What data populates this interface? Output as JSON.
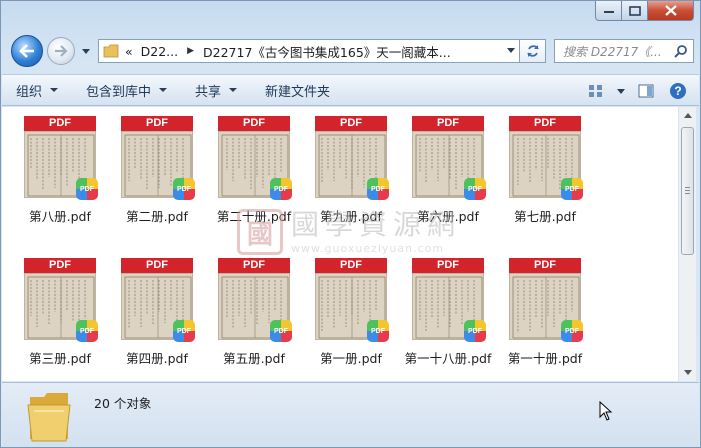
{
  "address": {
    "crumbs": [
      "«",
      "D22...",
      "D22717《古今图书集成165》天一阁藏本..."
    ]
  },
  "search": {
    "placeholder": "搜索 D22717《..."
  },
  "toolbar": {
    "organize": "组织",
    "include_in_library": "包含到库中",
    "share": "共享",
    "new_folder": "新建文件夹"
  },
  "files": [
    {
      "name": "第八册.pdf",
      "badge": "PDF",
      "type_label": "PDF"
    },
    {
      "name": "第二册.pdf",
      "badge": "PDF",
      "type_label": "PDF"
    },
    {
      "name": "第二十册.pdf",
      "badge": "PDF",
      "type_label": "PDF"
    },
    {
      "name": "第九册.pdf",
      "badge": "PDF",
      "type_label": "PDF"
    },
    {
      "name": "第六册.pdf",
      "badge": "PDF",
      "type_label": "PDF"
    },
    {
      "name": "第七册.pdf",
      "badge": "PDF",
      "type_label": "PDF"
    },
    {
      "name": "第三册.pdf",
      "badge": "PDF",
      "type_label": "PDF"
    },
    {
      "name": "第四册.pdf",
      "badge": "PDF",
      "type_label": "PDF"
    },
    {
      "name": "第五册.pdf",
      "badge": "PDF",
      "type_label": "PDF"
    },
    {
      "name": "第一册.pdf",
      "badge": "PDF",
      "type_label": "PDF"
    },
    {
      "name": "第一十八册.pdf",
      "badge": "PDF",
      "type_label": "PDF"
    },
    {
      "name": "第一十册.pdf",
      "badge": "PDF",
      "type_label": "PDF"
    }
  ],
  "watermark": {
    "seal": "國",
    "text": "國學資源網",
    "url": "www.guoxueziyuan.com"
  },
  "status": {
    "count": "20 个对象"
  },
  "colors": {
    "pdf_red": "#d3232b",
    "toolbar_text": "#1e395b",
    "close_red": "#c94f37"
  }
}
